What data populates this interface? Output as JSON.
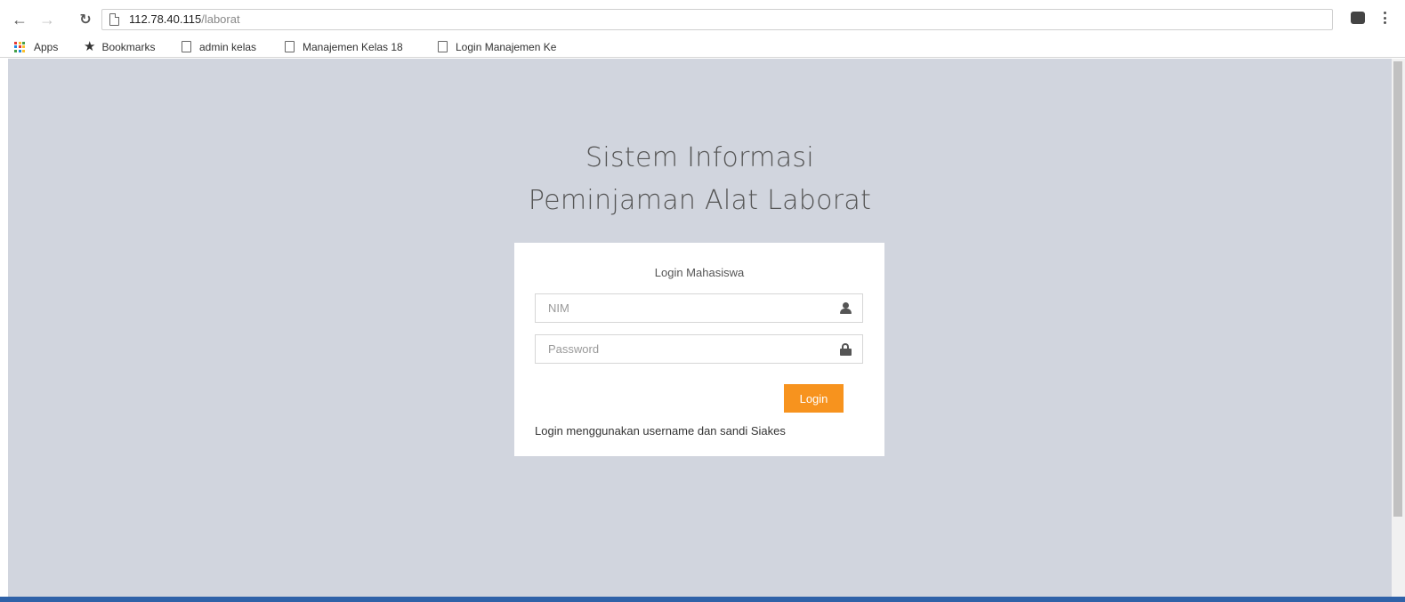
{
  "browser": {
    "url_host": "112.78.40.115",
    "url_path": "/laborat",
    "icons": [
      "back-icon",
      "forward-icon",
      "reload-icon",
      "page-icon",
      "extension-icon",
      "menu-icon"
    ]
  },
  "bookmarks_bar": {
    "items": [
      {
        "label": "Apps",
        "icon": "apps-icon"
      },
      {
        "label": "Bookmarks",
        "icon": "star-icon"
      },
      {
        "label": "admin kelas",
        "icon": "page-icon"
      },
      {
        "label": "Manajemen Kelas 18",
        "icon": "page-icon"
      },
      {
        "label": "Login Manajemen Ke",
        "icon": "page-icon"
      }
    ]
  },
  "page": {
    "background": "#d1d5de",
    "title_line1": "Sistem Informasi",
    "title_line2": "Peminjaman Alat Laborat",
    "login_card": {
      "heading": "Login Mahasiswa",
      "nim_placeholder": "NIM",
      "password_placeholder": "Password",
      "button_label": "Login",
      "button_color": "#f7931e",
      "note": "Login menggunakan username dan sandi Siakes"
    }
  }
}
